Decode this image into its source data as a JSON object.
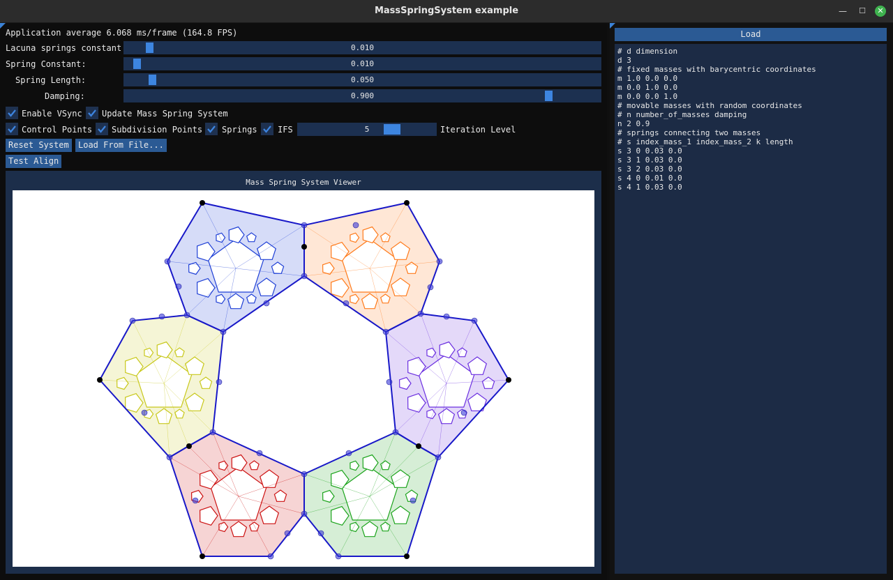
{
  "window": {
    "title": "MassSpringSystem example"
  },
  "stats": {
    "fps_text": "Application average 6.068 ms/frame (164.8 FPS)"
  },
  "sliders": [
    {
      "label": "Lacuna springs constant",
      "value": "0.010",
      "fraction": 0.04
    },
    {
      "label": "Spring Constant:",
      "value": "0.010",
      "fraction": 0.02
    },
    {
      "label": "Spring Length:",
      "value": "0.050",
      "fraction": 0.05
    },
    {
      "label": "Damping:",
      "value": "0.900",
      "fraction": 0.9
    }
  ],
  "checkboxes": {
    "vsync": {
      "label": "Enable VSync",
      "checked": true
    },
    "update": {
      "label": "Update Mass Spring System",
      "checked": true
    },
    "control_points": {
      "label": "Control Points",
      "checked": true
    },
    "subdivision_points": {
      "label": "Subdivision Points",
      "checked": true
    },
    "springs": {
      "label": "Springs",
      "checked": true
    },
    "ifs": {
      "label": "IFS",
      "checked": true
    }
  },
  "iteration": {
    "value": "5",
    "label": "Iteration Level"
  },
  "buttons": {
    "reset": "Reset System",
    "load_file": "Load From File...",
    "test_align": "Test Align"
  },
  "viewer": {
    "title": "Mass Spring System Viewer"
  },
  "right_panel": {
    "header": "Load",
    "lines": [
      "# d dimension",
      "d 3",
      "# fixed masses with barycentric coordinates",
      "m 1.0 0.0 0.0",
      "m 0.0 1.0 0.0",
      "m 0.0 0.0 1.0",
      "# movable masses with random coordinates",
      "# n number_of_masses damping",
      "n 2 0.9",
      "# springs connecting two masses",
      "# s index_mass_1 index_mass_2 k length",
      "s 3 0 0.03 0.0",
      "s 3 1 0.03 0.0",
      "s 3 2 0.03 0.0",
      "s 4 0 0.01 0.0",
      "s 4 1 0.03 0.0"
    ]
  },
  "colors": {
    "blue": "#1e3fd6",
    "orange": "#ff7a1a",
    "purple": "#6a2ee0",
    "green": "#1aa31a",
    "red": "#cc1010",
    "yellow": "#c8c81a",
    "outline": "#1818c8"
  }
}
